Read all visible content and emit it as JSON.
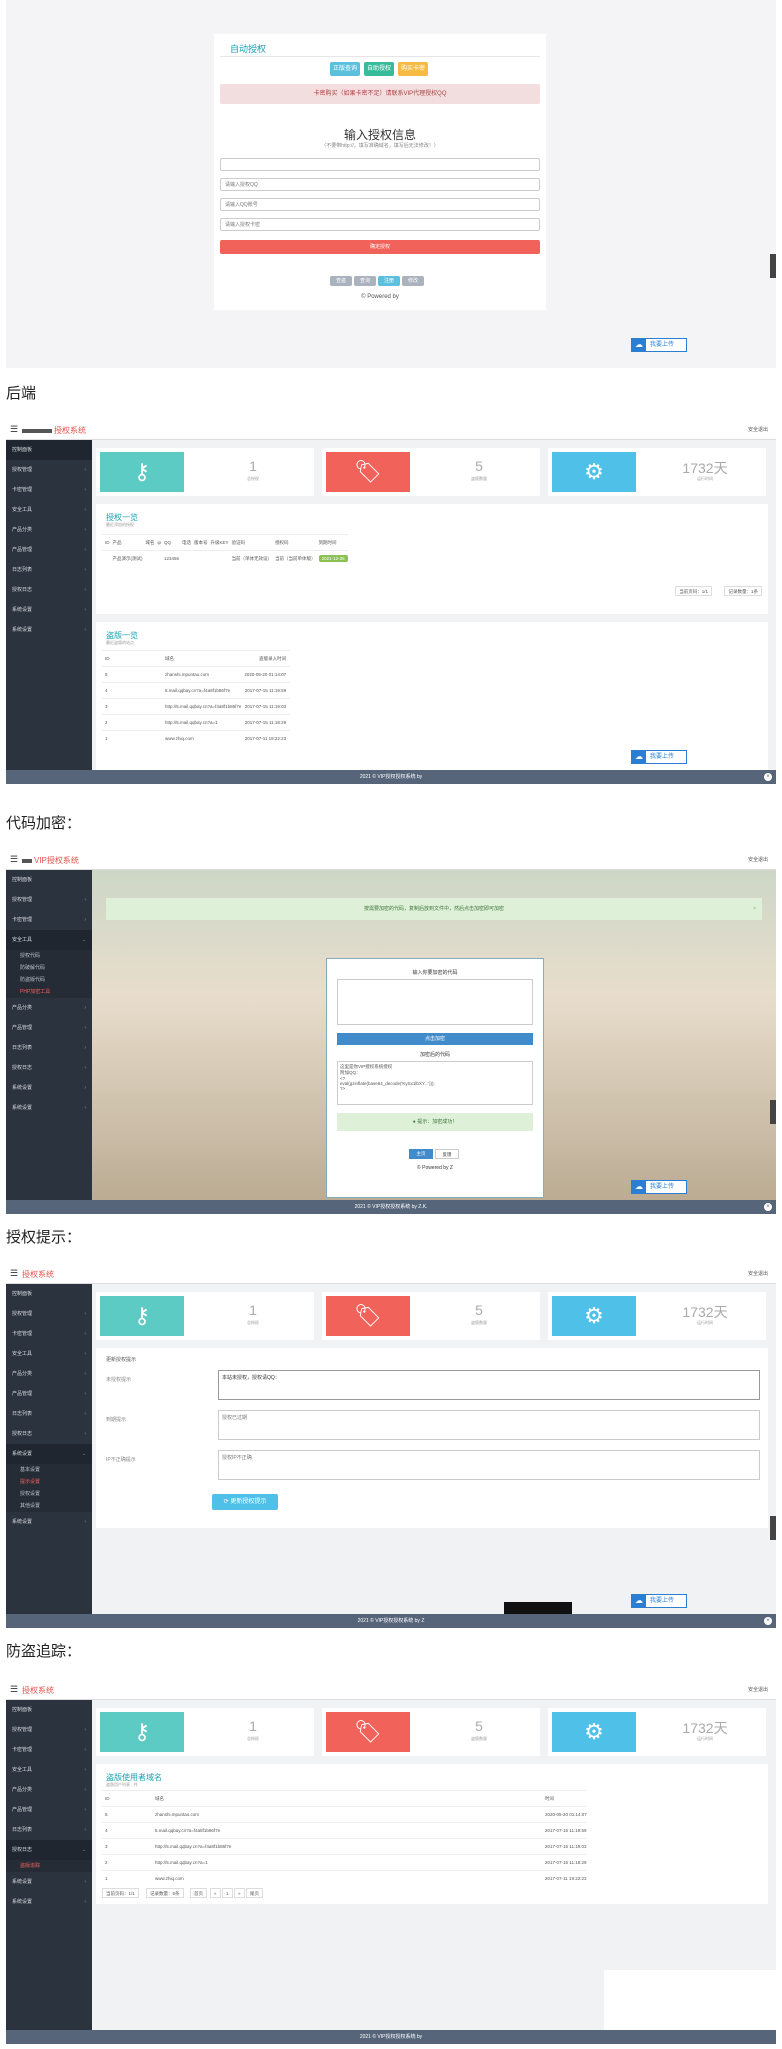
{
  "s1": {
    "title": "自动授权",
    "buttons": [
      "正版查询",
      "自助授权",
      "购买卡密"
    ],
    "alert": "卡密购买（如果卡密不足）请联系VIP代理授权QQ",
    "heading": "输入授权信息",
    "subheading": "（不要带http://，填写准确域名，填写后无法修改！）",
    "inputs": [
      "",
      "请输入授权QQ",
      "请输入QQ账号",
      "请输入授权卡密"
    ],
    "submit": "确定授权",
    "small_buttons": [
      "查盗",
      "查询",
      "注册",
      "修改"
    ],
    "powered": "© Powered by",
    "upload": "我要上传"
  },
  "labels": {
    "backend": "后端",
    "encrypt": "代码加密：",
    "tip": "授权提示：",
    "trace": "防盗追踪："
  },
  "admin": {
    "logo": "授权系统",
    "logo_vip": "VIP授权系统",
    "safe": "安全退出",
    "footer_a": "2021 © VIP授权授权系统 by",
    "footer_b": "2021 © VIP授权授权系统 by Z.K.",
    "footer_c": "2021 © VIP授权授权系统 by Z",
    "footer_d": "2021 © VIP授权授权系统 by",
    "stats": [
      {
        "num": "1",
        "label": "总授权"
      },
      {
        "num": "5",
        "label": "盗版数量"
      },
      {
        "num": "1732天",
        "label": "运行时间"
      }
    ]
  },
  "sidebar": {
    "items": [
      "控制面板",
      "授权管理",
      "卡密管理",
      "安全工具",
      "产品分类",
      "产品管理",
      "日志列表",
      "授权日志",
      "系统设置",
      "系统设置"
    ],
    "enc_sub": [
      "授权代码",
      "防破解代码",
      "防盗版代码",
      "PHP加密工具"
    ],
    "tip_sub": [
      "基本设置",
      "提示设置",
      "授权设置",
      "其他设置"
    ],
    "trace_sub": [
      "盗版追踪"
    ]
  },
  "s2": {
    "panel1": {
      "title": "授权一览",
      "sub": "最近添加的授权",
      "headers": [
        "ID",
        "产品",
        "域名",
        "ip",
        "QQ",
        "电话",
        "版本号",
        "升级KEY",
        "验证码",
        "授权码",
        "到期时间"
      ],
      "row": [
        "",
        "产品演示(测试)",
        "",
        "",
        "123456",
        "",
        "",
        "",
        "当前（单体无效设）",
        "当前（当前单体版）",
        "2021-12-26"
      ],
      "pager": [
        "当前页码：1/1",
        "记录数量：1条"
      ]
    },
    "panel2": {
      "title": "盗版一览",
      "sub": "最近盗版的站点",
      "headers": [
        "ID",
        "域名",
        "盗版录入时间"
      ],
      "rows": [
        [
          "5",
          "zhanshi.mpuntao.com",
          "2020-05-20 01:14:07"
        ],
        [
          "4",
          "5.mail.qqbay.cn?a=f4a8f1b86f7e",
          "2017-07-15 11:19:59"
        ],
        [
          "3",
          "http://5.mail.qqbay.cn?a=f4a8f1b86f7e",
          "2017-07-15 11:19:03"
        ],
        [
          "2",
          "http://5.mail.qqbay.cn?a=1",
          "2017-07-15 11:18:29"
        ],
        [
          "1",
          "www.zhiq.com",
          "2017-07-11 19:22:23"
        ]
      ]
    }
  },
  "s3": {
    "alert": "按需要加密的代码，复制后放到文件中，然后点击加密即可加密",
    "in_label": "输入你要加密的代码",
    "btn": "点击加密",
    "out_label": "加密后的代码",
    "code": "这里是你VIP授权系统授权\n附加QQ：\n<?\neval(gzinflate(base64_decode('KySx1lbXY...')));\n?>",
    "tip": "提示：加密成功！",
    "s_btns": [
      "主页",
      "反馈"
    ],
    "powered": "© Powered by Z"
  },
  "s4": {
    "title": "更新授权提示",
    "rows": [
      {
        "label": "未授权提示",
        "value": "本站未授权，授权请QQ："
      },
      {
        "label": "到期提示",
        "value": "授权已过期"
      },
      {
        "label": "IP不正确提示",
        "value": "授权IP不正确"
      }
    ],
    "btn": "更新授权提示"
  },
  "s5": {
    "title": "盗版使用者域名",
    "sub": "盗版用户列表 - 共",
    "headers": [
      "ID",
      "域名",
      "时间"
    ],
    "rows": [
      [
        "5",
        "zhanshi.mpuntao.com",
        "2020-05-20 01:14:07"
      ],
      [
        "4",
        "5.mail.qqbay.cn?a=f4a8f1b86f7e",
        "2017-07-15 11:19:59"
      ],
      [
        "3",
        "http://5.mail.qqbay.cn?a=f4a8f1b86f7e",
        "2017-07-15 11:19:03"
      ],
      [
        "2",
        "http://5.mail.qqbay.cn?a=1",
        "2017-07-15 11:18:29"
      ],
      [
        "1",
        "www.zhiq.com",
        "2017-07-11 19:22:23"
      ]
    ],
    "pager": [
      "当前页码：1/1",
      "记录数量：5条",
      "首页",
      "«",
      "1",
      "»",
      "尾页"
    ]
  }
}
